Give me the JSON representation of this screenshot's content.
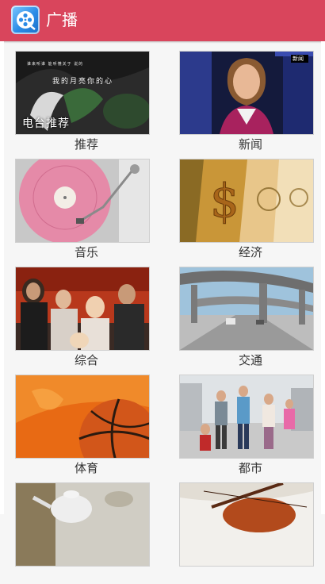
{
  "header": {
    "title": "广播",
    "icon": "video-reel-icon",
    "background_color": "#d9455c"
  },
  "categories": [
    {
      "label": "推荐",
      "image": "recommend-cover-image",
      "cover_caption": "电台推荐",
      "cover_line1": "谁来听谁 能听懂关于  说的",
      "cover_line2": "我的月亮你的心"
    },
    {
      "label": "新闻",
      "image": "news-anchor-image",
      "cover_badge": "新闻"
    },
    {
      "label": "音乐",
      "image": "vinyl-record-image"
    },
    {
      "label": "经济",
      "image": "dollar-bills-image"
    },
    {
      "label": "综合",
      "image": "group-of-friends-image"
    },
    {
      "label": "交通",
      "image": "highway-overpass-image"
    },
    {
      "label": "体育",
      "image": "basketball-image"
    },
    {
      "label": "都市",
      "image": "city-people-image"
    },
    {
      "label": "",
      "image": "teapot-image"
    },
    {
      "label": "",
      "image": "violin-image"
    }
  ]
}
